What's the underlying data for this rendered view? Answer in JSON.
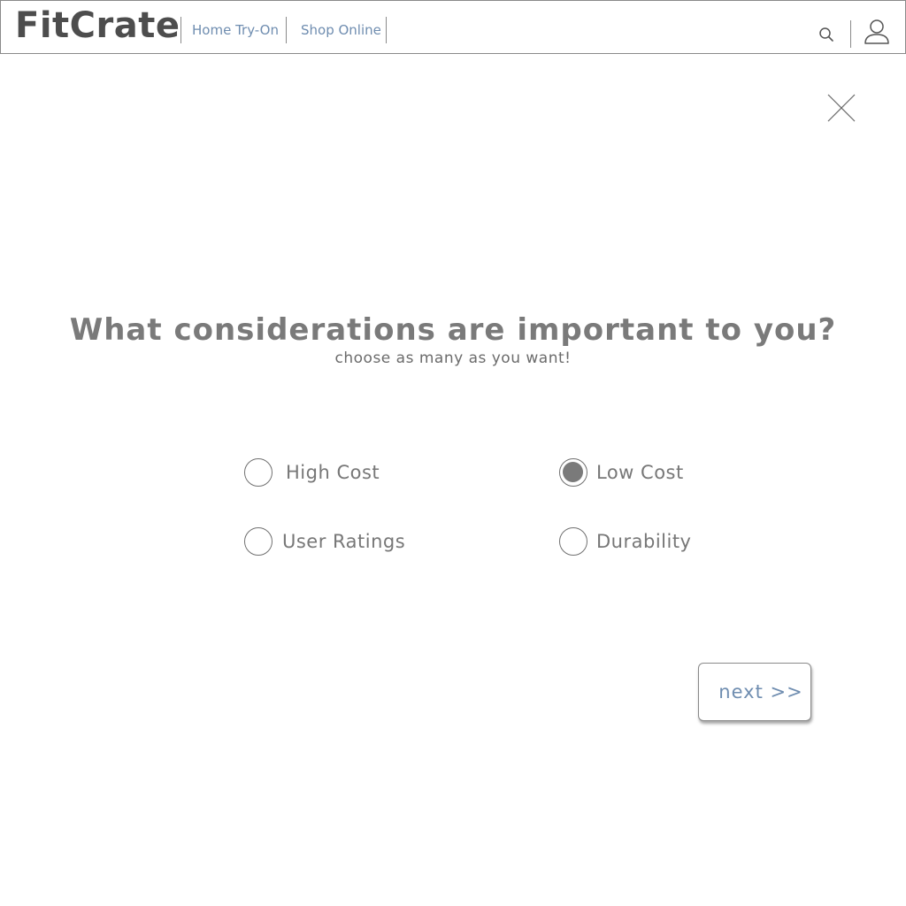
{
  "header": {
    "logo": "FitCrate",
    "nav": [
      {
        "label": "Home Try-On"
      },
      {
        "label": "Shop Online"
      }
    ],
    "icons": {
      "search": "search-icon",
      "user": "user-icon"
    }
  },
  "dialog": {
    "close_icon": "close-icon",
    "question": "What considerations are important to you?",
    "subtitle": "choose as many as you want!",
    "options": [
      {
        "label": "High Cost",
        "checked": false
      },
      {
        "label": "Low Cost",
        "checked": true
      },
      {
        "label": "User Ratings",
        "checked": false
      },
      {
        "label": "Durability",
        "checked": false
      }
    ],
    "next_label": "next >>"
  },
  "colors": {
    "link": "#6f8db0",
    "text": "#7a7a7a",
    "border": "#8a8a8a",
    "radio_fill": "#7a7a7a"
  }
}
